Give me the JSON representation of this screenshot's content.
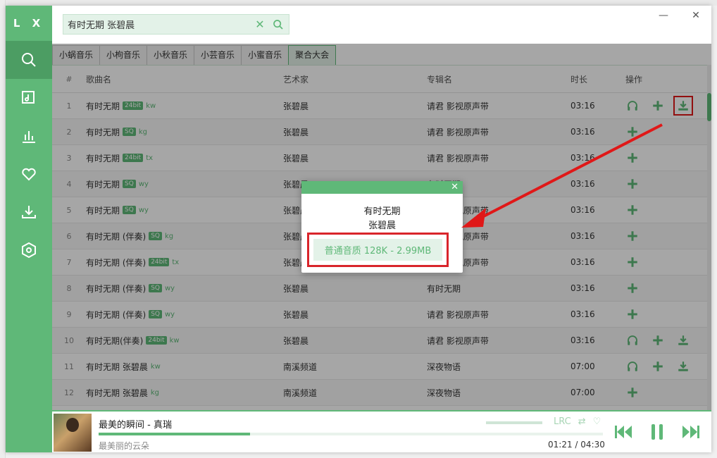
{
  "app": {
    "logo": "L X"
  },
  "search": {
    "value": "有时无期  张碧晨"
  },
  "tabs": [
    {
      "label": "小蜗音乐",
      "active": false
    },
    {
      "label": "小枸音乐",
      "active": false
    },
    {
      "label": "小秋音乐",
      "active": false
    },
    {
      "label": "小芸音乐",
      "active": false
    },
    {
      "label": "小蜜音乐",
      "active": false
    },
    {
      "label": "聚合大会",
      "active": true
    }
  ],
  "table": {
    "headers": {
      "idx": "#",
      "name": "歌曲名",
      "artist": "艺术家",
      "album": "专辑名",
      "duration": "时长",
      "ops": "操作"
    },
    "rows": [
      {
        "idx": "1",
        "name": "有时无期",
        "badge": "24bit",
        "src": "kw",
        "artist": "张碧晨",
        "album": "请君 影视原声带",
        "duration": "03:16",
        "ops": [
          "listen",
          "add",
          "download"
        ]
      },
      {
        "idx": "2",
        "name": "有时无期",
        "badge": "SQ",
        "src": "kg",
        "artist": "张碧晨",
        "album": "请君 影视原声带",
        "duration": "03:16",
        "ops": [
          "add"
        ]
      },
      {
        "idx": "3",
        "name": "有时无期",
        "badge": "24bit",
        "src": "tx",
        "artist": "张碧晨",
        "album": "请君 影视原声带",
        "duration": "03:16",
        "ops": [
          "add"
        ]
      },
      {
        "idx": "4",
        "name": "有时无期",
        "badge": "SQ",
        "src": "wy",
        "artist": "张碧晨",
        "album": "有时无期",
        "duration": "03:16",
        "ops": [
          "add"
        ]
      },
      {
        "idx": "5",
        "name": "有时无期",
        "badge": "SQ",
        "src": "wy",
        "artist": "张碧晨",
        "album": "请君 影视原声带",
        "duration": "03:16",
        "ops": [
          "add"
        ]
      },
      {
        "idx": "6",
        "name": "有时无期 (伴奏)",
        "badge": "SQ",
        "src": "kg",
        "artist": "张碧晨",
        "album": "请君 影视原声带",
        "duration": "03:16",
        "ops": [
          "add"
        ]
      },
      {
        "idx": "7",
        "name": "有时无期 (伴奏)",
        "badge": "24bit",
        "src": "tx",
        "artist": "张碧晨",
        "album": "请君 影视原声带",
        "duration": "03:16",
        "ops": [
          "add"
        ]
      },
      {
        "idx": "8",
        "name": "有时无期 (伴奏)",
        "badge": "SQ",
        "src": "wy",
        "artist": "张碧晨",
        "album": "有时无期",
        "duration": "03:16",
        "ops": [
          "add"
        ]
      },
      {
        "idx": "9",
        "name": "有时无期 (伴奏)",
        "badge": "SQ",
        "src": "wy",
        "artist": "张碧晨",
        "album": "请君 影视原声带",
        "duration": "03:16",
        "ops": [
          "add"
        ]
      },
      {
        "idx": "10",
        "name": "有时无期(伴奏)",
        "badge": "24bit",
        "src": "kw",
        "artist": "张碧晨",
        "album": "请君 影视原声带",
        "duration": "03:16",
        "ops": [
          "listen",
          "add",
          "download"
        ]
      },
      {
        "idx": "11",
        "name": "有时无期 张碧晨",
        "badge": "",
        "src": "kw",
        "artist": "南溪频道",
        "album": "深夜物语",
        "duration": "07:00",
        "ops": [
          "listen",
          "add",
          "download"
        ]
      },
      {
        "idx": "12",
        "name": "有时无期 张碧晨",
        "badge": "",
        "src": "kg",
        "artist": "南溪频道",
        "album": "深夜物语",
        "duration": "07:00",
        "ops": [
          "add"
        ]
      }
    ]
  },
  "dialog": {
    "title": "有时无期",
    "artist": "张碧晨",
    "option": "普通音质 128K - 2.99MB",
    "close": "✕"
  },
  "player": {
    "title": "最美的瞬间 - 真瑞",
    "subtitle": "最美丽的云朵",
    "current_time": "01:21",
    "total_time": "04:30",
    "time_sep": "/",
    "progress": 0.3,
    "lrc_label": "LRC"
  },
  "colors": {
    "accent": "#5fb878",
    "highlight": "#e01818"
  }
}
